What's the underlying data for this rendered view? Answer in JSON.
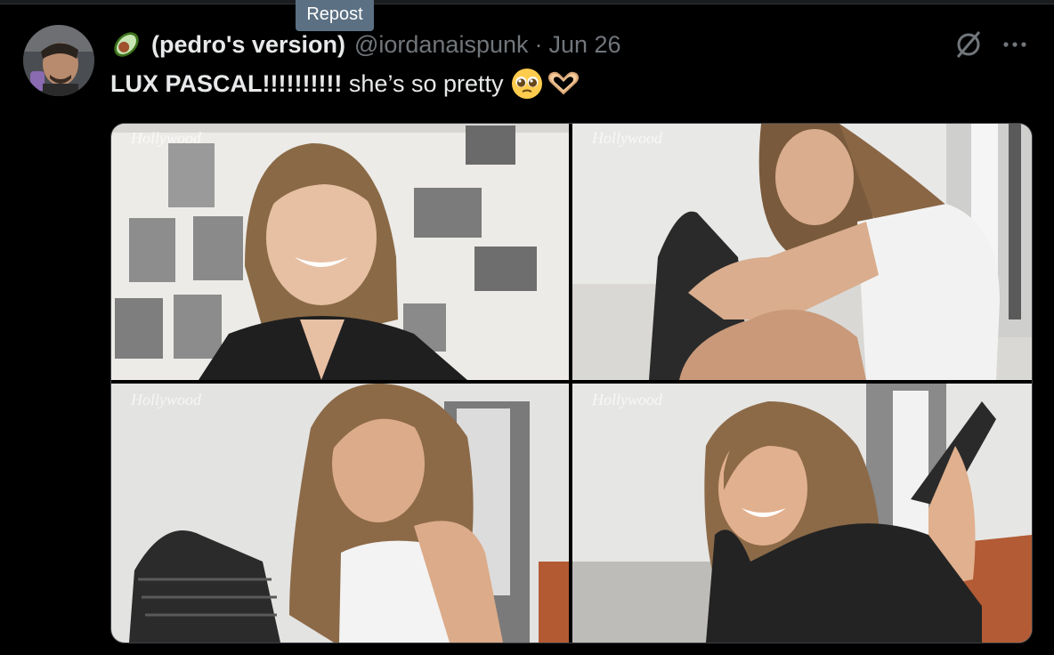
{
  "tooltip": {
    "label": "Repost"
  },
  "author": {
    "emoji_name": "avocado-icon",
    "display_name": "(pedro's version)",
    "handle": "@iordanaispunk",
    "separator": "·",
    "date": "Jun 26"
  },
  "tweet": {
    "text_bold": "LUX PASCAL!!!!!!!!!!",
    "text_rest": " she’s so pretty",
    "emojis": [
      "pleading-face-icon",
      "heart-hands-icon"
    ]
  },
  "media": {
    "watermark": "Hollywood",
    "photos": [
      {
        "name": "photo-1",
        "description_icon": "image"
      },
      {
        "name": "photo-2",
        "description_icon": "image"
      },
      {
        "name": "photo-3",
        "description_icon": "image"
      },
      {
        "name": "photo-4",
        "description_icon": "image"
      }
    ]
  },
  "colors": {
    "background": "#000000",
    "text_primary": "#e7e9ea",
    "text_secondary": "#71767b",
    "tooltip_bg": "#5b7083"
  }
}
